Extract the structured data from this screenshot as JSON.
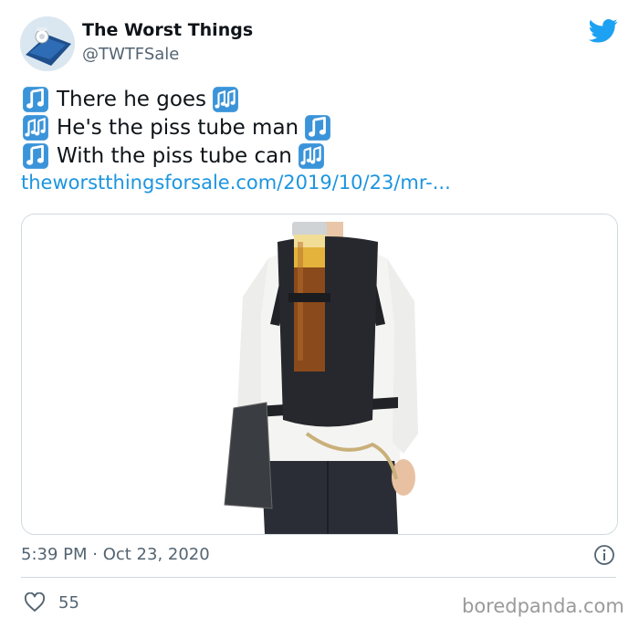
{
  "tweet": {
    "author_name": "The Worst Things",
    "author_handle": "@TWTFSale",
    "lines": [
      "There he goes",
      "He's the piss tube man",
      "With the piss tube can"
    ],
    "link": "theworstthingsforsale.com/2019/10/23/mr-...",
    "timestamp": "5:39 PM · Oct 23, 2020",
    "likes": "55"
  },
  "watermark": "boredpanda.com",
  "icons": {
    "logo": "twitter-bird-icon",
    "note_single": "music-note-icon",
    "note_double": "music-notes-icon",
    "info": "info-icon",
    "like": "heart-icon"
  },
  "colors": {
    "link": "#1b95e0",
    "brand": "#1da1f2",
    "note": "#3b94d9",
    "secondary_text": "#536471"
  }
}
